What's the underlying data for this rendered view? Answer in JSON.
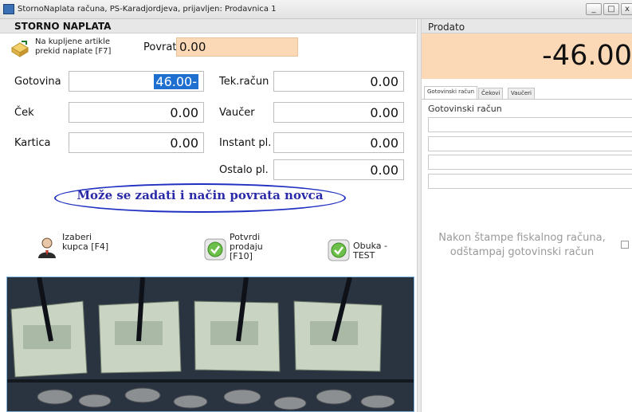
{
  "window": {
    "title": "StornoNaplata računa, PS-Karadjordjeva, prijavljen: Prodavnica 1",
    "minimize_glyph": "_",
    "maximize_glyph": "□",
    "close_glyph": "x"
  },
  "storno": {
    "title": "STORNO NAPLATA",
    "return_items_label": "Na kupljene artikle prekid naplate [F7]",
    "povrat_label": "Povrat",
    "povrat_value": "0.00"
  },
  "payments": {
    "gotovina_label": "Gotovina",
    "gotovina_value": "46.00-",
    "cek_label": "Ček",
    "cek_value": "0.00",
    "kartica_label": "Kartica",
    "kartica_value": "0.00",
    "tekracun_label": "Tek.račun",
    "tekracun_value": "0.00",
    "vaucer_label": "Vaučer",
    "vaucer_value": "0.00",
    "instant_label": "Instant pl.",
    "instant_value": "0.00",
    "ostalo_label": "Ostalo pl.",
    "ostalo_value": "0.00"
  },
  "hint": "Može se zadati i način povrata novca",
  "actions": {
    "izaberi_kupca": "Izaberi kupca [F4]",
    "potvrdi_prodaju": "Potvrdi prodaju [F10]",
    "obuka": "Obuka - TEST"
  },
  "prodato": {
    "title": "Prodato",
    "amount": "-46.00"
  },
  "tabs": [
    "Gotovinski račun",
    "Čekovi",
    "Vaučeri"
  ],
  "gotovinski_racun_title": "Gotovinski račun",
  "nakon_stampe": "Nakon štampe fiskalnog računa, odštampaj gotovinski račun",
  "colors": {
    "accent_orange": "#fcd9b6",
    "selection_blue": "#1f6fd1",
    "hint_blue": "#2a2aa8"
  }
}
